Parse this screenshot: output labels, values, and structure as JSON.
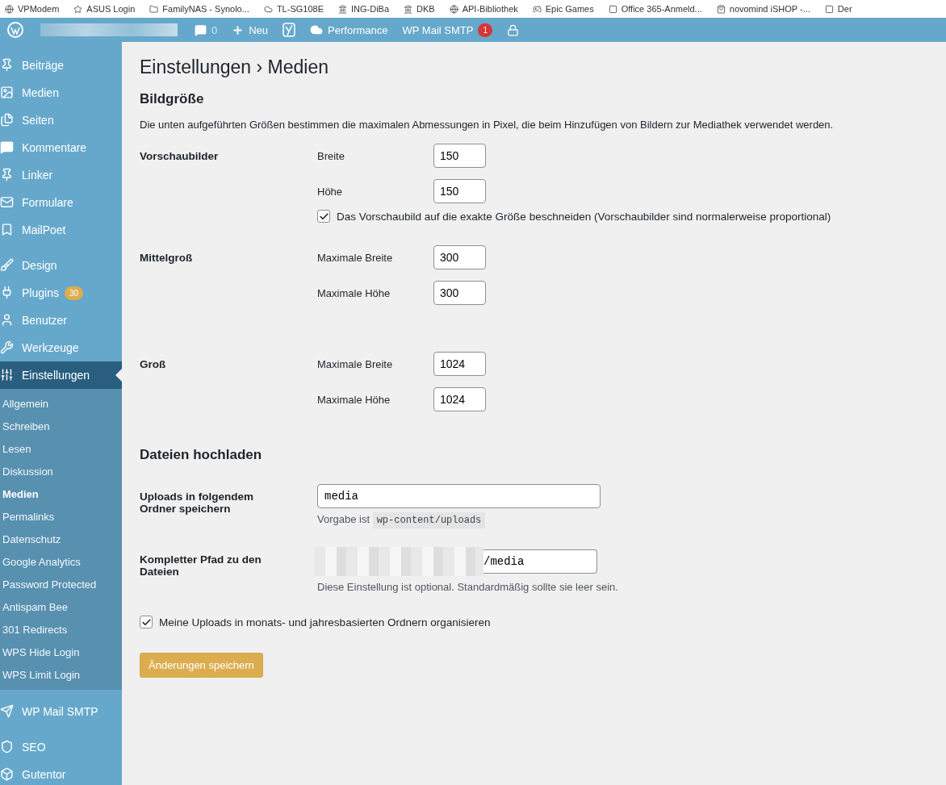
{
  "bookmarks": [
    "VPModem",
    "ASUS Login",
    "FamilyNAS - Synolo...",
    "TL-SG108E",
    "ING-DiBa",
    "DKB",
    "API-Bibliothek",
    "Epic Games",
    "Office 365-Anmeld...",
    "novomind iSHOP -...",
    "Der"
  ],
  "admin_bar": {
    "comments": "0",
    "new": "Neu",
    "performance": "Performance",
    "smtp": "WP Mail SMTP",
    "smtp_badge": "1"
  },
  "sidebar": {
    "groups": [
      {
        "items": [
          {
            "label": "Beiträge",
            "selected": false
          },
          {
            "label": "Medien",
            "selected": false
          },
          {
            "label": "Seiten",
            "selected": false
          },
          {
            "label": "Kommentare",
            "selected": false
          },
          {
            "label": "Linker",
            "selected": false
          },
          {
            "label": "Formulare",
            "selected": false
          },
          {
            "label": "MailPoet",
            "selected": false
          }
        ]
      },
      {
        "items": [
          {
            "label": "Design",
            "selected": false
          },
          {
            "label": "Plugins",
            "selected": false,
            "badge": "30"
          },
          {
            "label": "Benutzer",
            "selected": false
          },
          {
            "label": "Werkzeuge",
            "selected": false
          },
          {
            "label": "Einstellungen",
            "selected": true,
            "children": [
              {
                "label": "Allgemein",
                "selected": false
              },
              {
                "label": "Schreiben",
                "selected": false
              },
              {
                "label": "Lesen",
                "selected": false
              },
              {
                "label": "Diskussion",
                "selected": false
              },
              {
                "label": "Medien",
                "selected": true
              },
              {
                "label": "Permalinks",
                "selected": false
              },
              {
                "label": "Datenschutz",
                "selected": false
              },
              {
                "label": "Google Analytics",
                "selected": false
              },
              {
                "label": "Password Protected",
                "selected": false
              },
              {
                "label": "Antispam Bee",
                "selected": false
              },
              {
                "label": "301 Redirects",
                "selected": false
              },
              {
                "label": "WPS Hide Login",
                "selected": false
              },
              {
                "label": "WPS Limit Login",
                "selected": false
              }
            ]
          }
        ]
      },
      {
        "items": [
          {
            "label": "WP Mail SMTP",
            "selected": false
          }
        ]
      },
      {
        "items": [
          {
            "label": "SEO",
            "selected": false
          },
          {
            "label": "Gutentor",
            "selected": false
          }
        ]
      }
    ]
  },
  "page": {
    "title": "Einstellungen › Medien",
    "image_sizes": {
      "heading": "Bildgröße",
      "description": "Die unten aufgeführten Größen bestimmen die maximalen Abmessungen in Pixel, die beim Hinzufügen von Bildern zur Mediathek verwendet werden.",
      "groups": [
        {
          "label": "Vorschaubilder",
          "fields": [
            {
              "label": "Breite",
              "value": "150"
            },
            {
              "label": "Höhe",
              "value": "150"
            }
          ],
          "crop": {
            "label": "Das Vorschaubild auf die exakte Größe beschneiden (Vorschaubilder sind normalerweise proportional)",
            "checked": true
          }
        },
        {
          "label": "Mittelgroß",
          "fields": [
            {
              "label": "Maximale Breite",
              "value": "300"
            },
            {
              "label": "Maximale Höhe",
              "value": "300"
            }
          ]
        },
        {
          "label": "Groß",
          "fields": [
            {
              "label": "Maximale Breite",
              "value": "1024"
            },
            {
              "label": "Maximale Höhe",
              "value": "1024"
            }
          ]
        }
      ]
    },
    "uploads": {
      "heading": "Dateien hochladen",
      "folder": {
        "label": "Uploads in folgendem Ordner speichern",
        "value": "media",
        "hint": "Vorgabe ist",
        "hint_code": "wp-content/uploads"
      },
      "path": {
        "label": "Kompletter Pfad zu den Dateien",
        "value": "/media",
        "hint": "Diese Einstellung ist optional. Standardmäßig sollte sie leer sein."
      },
      "organize": {
        "label": "Meine Uploads in monats- und jahresbasierten Ordnern organisieren",
        "checked": true
      }
    },
    "save_button": "Änderungen speichern"
  }
}
